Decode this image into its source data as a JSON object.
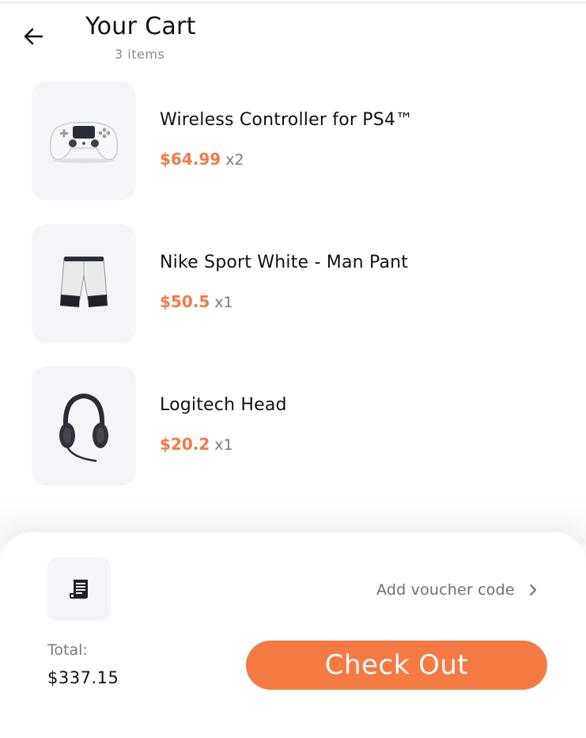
{
  "header": {
    "title": "Your Cart",
    "subtitle": "3 items",
    "back_icon": "arrow-left-icon"
  },
  "cart": {
    "items": [
      {
        "name": "Wireless Controller for PS4™",
        "price": "$64.99",
        "qty": "x2",
        "image": "game-controller"
      },
      {
        "name": "Nike Sport White - Man Pant",
        "price": "$50.5",
        "qty": "x1",
        "image": "sport-shorts"
      },
      {
        "name": "Logitech Head",
        "price": "$20.2",
        "qty": "x1",
        "image": "headset"
      }
    ]
  },
  "footer": {
    "voucher_icon": "receipt-icon",
    "voucher_label": "Add voucher code",
    "total_label": "Total:",
    "total_value": "$337.15",
    "checkout_label": "Check Out"
  },
  "colors": {
    "accent": "#f47a44",
    "thumb_bg": "#f4f5f8",
    "muted_text": "#7a7a7a"
  }
}
